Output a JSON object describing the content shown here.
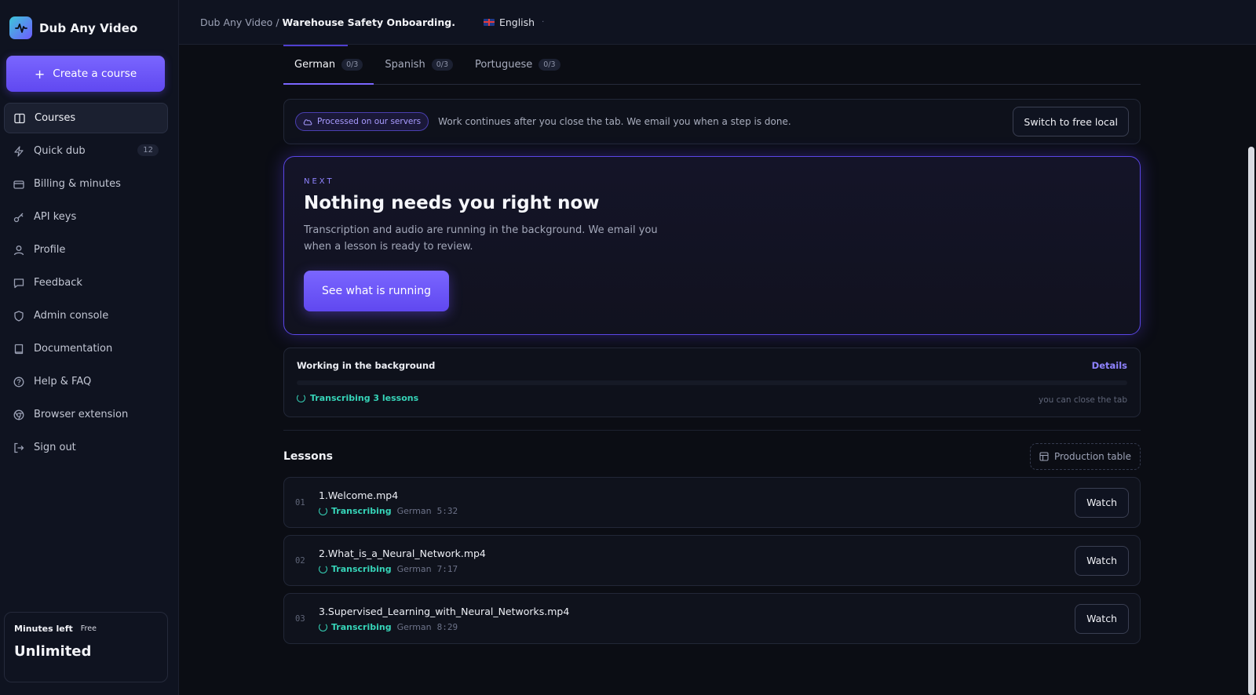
{
  "app": {
    "name": "Dub Any Video"
  },
  "sidebar": {
    "create_label": "Create a course",
    "items": [
      {
        "label": "Courses",
        "icon": "book-open-icon",
        "active": true
      },
      {
        "label": "Quick dub",
        "icon": "bolt-icon",
        "badge": "12"
      },
      {
        "label": "Billing & minutes",
        "icon": "credit-card-icon"
      },
      {
        "label": "API keys",
        "icon": "key-icon"
      },
      {
        "label": "Profile",
        "icon": "user-icon"
      },
      {
        "label": "Feedback",
        "icon": "chat-icon"
      },
      {
        "label": "Admin console",
        "icon": "shield-icon"
      },
      {
        "label": "Documentation",
        "icon": "book-icon"
      },
      {
        "label": "Help & FAQ",
        "icon": "help-circle-icon"
      },
      {
        "label": "Browser extension",
        "icon": "chrome-icon"
      },
      {
        "label": "Sign out",
        "icon": "sign-out-icon"
      }
    ],
    "minutes": {
      "label": "Minutes left",
      "tier": "Free",
      "value": "Unlimited"
    }
  },
  "topbar": {
    "breadcrumb_root": "Dub Any Video",
    "breadcrumb_sep": "/",
    "breadcrumb_current": "Warehouse Safety Onboarding.",
    "language": "English"
  },
  "tabs": [
    {
      "label": "German",
      "count": "0/3",
      "active": true
    },
    {
      "label": "Spanish",
      "count": "0/3"
    },
    {
      "label": "Portuguese",
      "count": "0/3"
    }
  ],
  "server_bar": {
    "pill": "Processed on our servers",
    "text": "Work continues after you close the tab. We email you when a step is done.",
    "button": "Switch to free local"
  },
  "next": {
    "eyebrow": "NEXT",
    "title": "Nothing needs you right now",
    "description": "Transcription and audio are running in the background. We email you when a lesson is ready to review.",
    "button": "See what is running"
  },
  "background": {
    "title": "Working in the background",
    "details": "Details",
    "status": "Transcribing 3 lessons",
    "hint": "you can close the tab",
    "progress": 0
  },
  "lessons": {
    "title": "Lessons",
    "table_button": "Production table",
    "items": [
      {
        "num": "01",
        "name": "1.Welcome.mp4",
        "status": "Transcribing",
        "lang": "German",
        "duration": "5:32",
        "action": "Watch"
      },
      {
        "num": "02",
        "name": "2.What_is_a_Neural_Network.mp4",
        "status": "Transcribing",
        "lang": "German",
        "duration": "7:17",
        "action": "Watch"
      },
      {
        "num": "03",
        "name": "3.Supervised_Learning_with_Neural_Networks.mp4",
        "status": "Transcribing",
        "lang": "German",
        "duration": "8:29",
        "action": "Watch"
      }
    ]
  },
  "colors": {
    "accent": "#6f5bff",
    "status_teal": "#36d4b8",
    "background": "#0b0d14"
  }
}
